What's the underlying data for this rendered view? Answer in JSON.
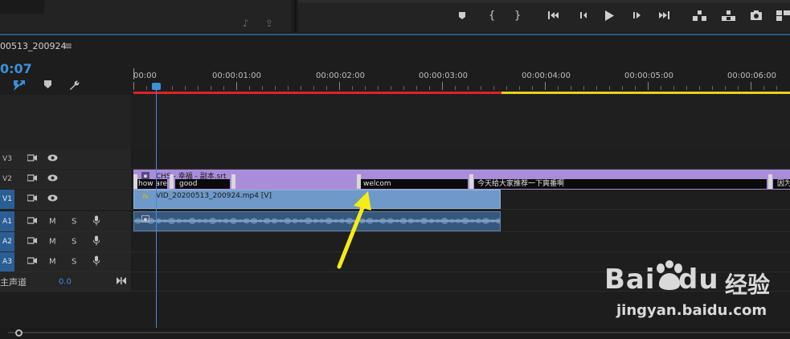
{
  "sequence": {
    "tab_name": "00513_200924",
    "menu_glyph": "≡",
    "timecode": "0:07"
  },
  "ruler": {
    "labels": [
      "00:00",
      "00:00:01:00",
      "00:00:02:00",
      "00:00:03:00",
      "00:00:04:00",
      "00:00:05:00",
      "00:00:06:00"
    ]
  },
  "tracks": {
    "v3": {
      "id": "V3"
    },
    "v2": {
      "id": "V2"
    },
    "v1": {
      "id": "V1"
    },
    "a1": {
      "id": "A1",
      "m": "M",
      "s": "S"
    },
    "a2": {
      "id": "A2",
      "m": "M",
      "s": "S"
    },
    "a3": {
      "id": "A3",
      "m": "M",
      "s": "S"
    },
    "master": {
      "label": "主声道",
      "value": "0.0"
    }
  },
  "clips": {
    "subtitle_title": "CHS - 幸福 - 副本.srt",
    "subtitles": [
      "how are y",
      "good",
      "welcom",
      "今天给大家推荐一下爽番啊",
      "因为"
    ],
    "video_title": "VID_20200513_200924.mp4 [V]",
    "fx_label": "fx"
  },
  "watermark": {
    "brand": "Bai",
    "brand_suffix": "du",
    "cn": "经验",
    "url": "jingyan.baidu.com"
  },
  "colors": {
    "accent": "#3d8fd9",
    "render_red": "#e0232a",
    "render_yellow": "#e4d31c",
    "subtitle_clip": "#a98ddb",
    "video_clip": "#6e99c9",
    "audio_clip": "#36577c",
    "arrow": "#f4ec14"
  }
}
